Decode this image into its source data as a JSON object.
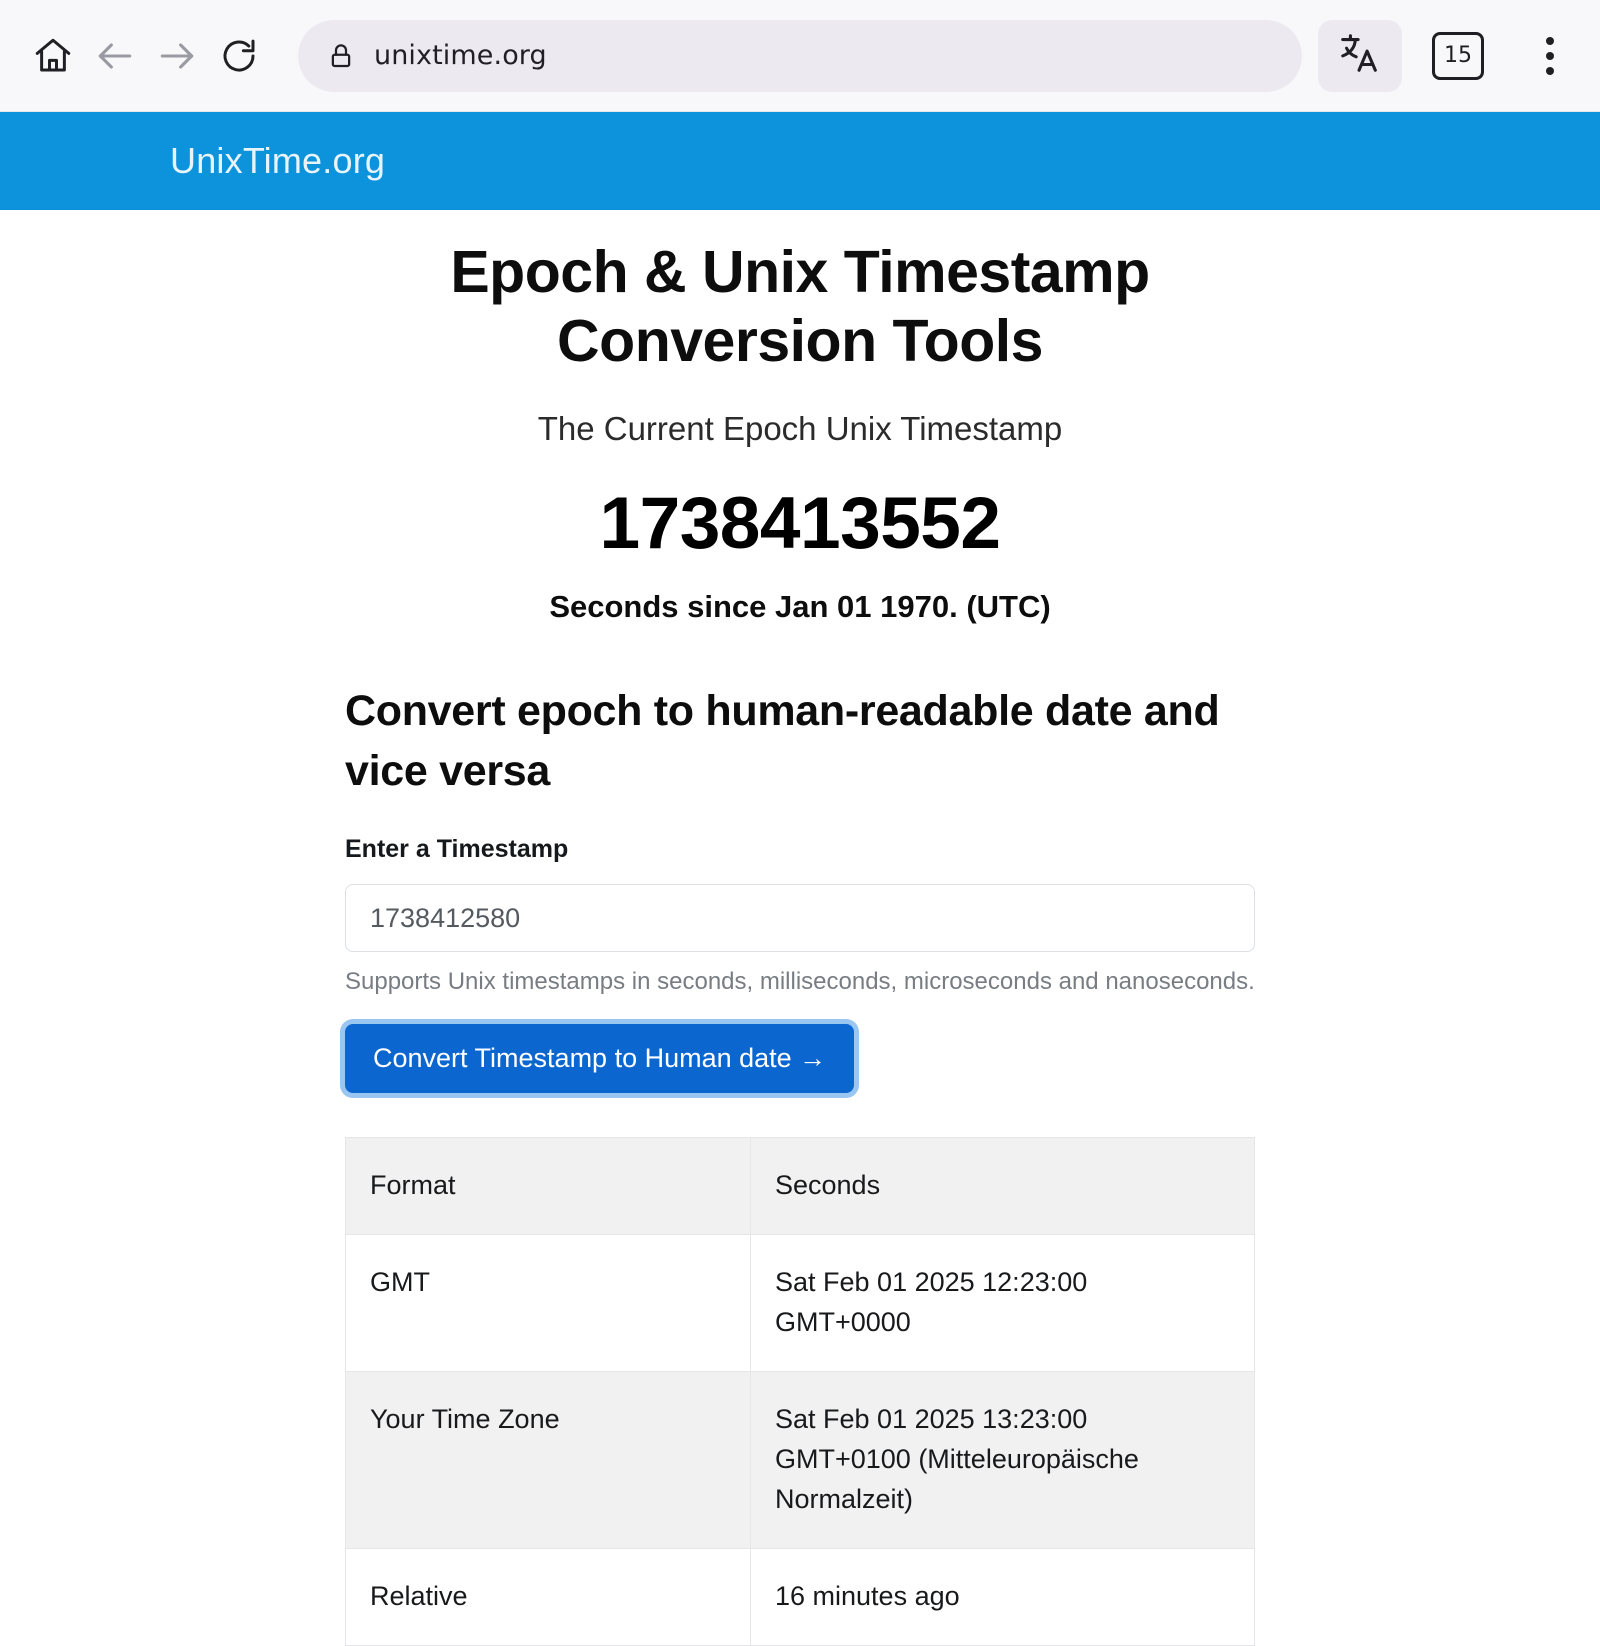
{
  "browser": {
    "home_icon": "home-icon",
    "back_icon": "back-arrow-icon",
    "forward_icon": "forward-arrow-icon",
    "reload_icon": "reload-icon",
    "lock_icon": "lock-icon",
    "url": "unixtime.org",
    "translate_icon": "translate-icon",
    "tab_count": "15",
    "menu_icon": "three-dot-menu-icon"
  },
  "site": {
    "brand": "UnixTime.org",
    "navbar_color": "#0d93db"
  },
  "hero": {
    "title": "Epoch & Unix Timestamp Conversion Tools",
    "subtitle": "The Current Epoch Unix Timestamp",
    "current_epoch": "1738413552",
    "epoch_note": "Seconds since Jan 01 1970. (UTC)"
  },
  "converter": {
    "section_title": "Convert epoch to human-readable date and vice versa",
    "input_label": "Enter a Timestamp",
    "input_value": "1738412580",
    "input_placeholder": "1738412580",
    "help_text": "Supports Unix timestamps in seconds, milliseconds, microseconds and nanoseconds.",
    "button_label": "Convert Timestamp to Human date  →",
    "button_color": "#0b66d0"
  },
  "results": {
    "headers": [
      "Format",
      "Seconds"
    ],
    "rows": [
      {
        "format": "GMT",
        "value": "Sat Feb 01 2025 12:23:00 GMT+0000"
      },
      {
        "format": "Your Time Zone",
        "value": "Sat Feb 01 2025 13:23:00 GMT+0100 (Mitteleuropäische Normalzeit)"
      },
      {
        "format": "Relative",
        "value": "16 minutes ago"
      }
    ]
  }
}
